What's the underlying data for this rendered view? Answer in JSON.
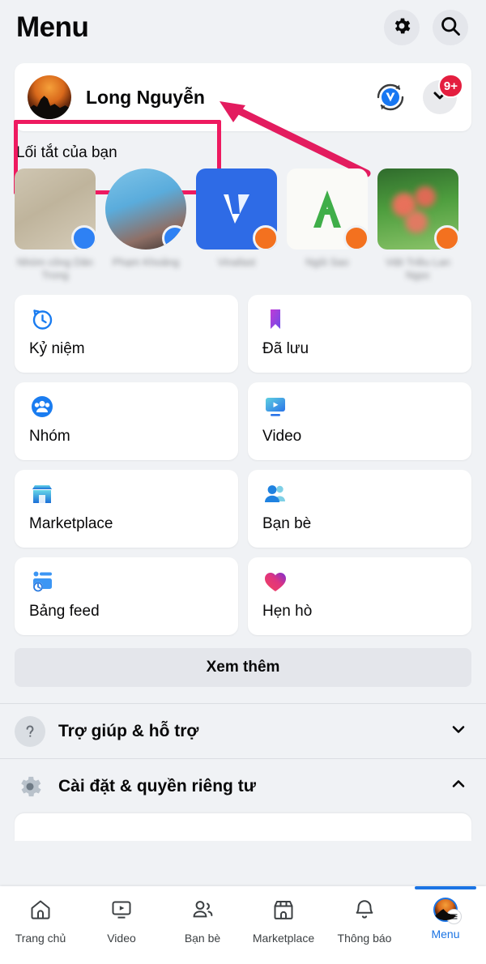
{
  "header": {
    "title": "Menu",
    "settings_icon": "gear-icon",
    "search_icon": "search-icon"
  },
  "profile": {
    "name": "Long Nguyễn",
    "switch_account_icon": "account-switch-icon",
    "expand_icon": "chevron-down-icon",
    "notification_badge": "9+"
  },
  "annotation": {
    "highlight_color": "#EE1A60",
    "arrow_color": "#E31C5F"
  },
  "shortcuts": {
    "label": "Lối tắt của bạn",
    "items": [
      {
        "label": "Nhóm công Dân Trong",
        "badge": "group-badge-blue"
      },
      {
        "label": "Phạm Khoảng",
        "badge": "group-badge-blue"
      },
      {
        "label": "Vinafast",
        "badge": "page-badge-orange"
      },
      {
        "label": "Ngôi Sao",
        "badge": "page-badge-orange"
      },
      {
        "label": "Việt Triều Lan Ngọc",
        "badge": "page-badge-orange"
      }
    ]
  },
  "tiles": [
    {
      "label": "Kỷ niệm",
      "icon": "memories-clock-icon"
    },
    {
      "label": "Đã lưu",
      "icon": "bookmark-icon"
    },
    {
      "label": "Nhóm",
      "icon": "groups-icon"
    },
    {
      "label": "Video",
      "icon": "video-icon"
    },
    {
      "label": "Marketplace",
      "icon": "marketplace-icon"
    },
    {
      "label": "Bạn bè",
      "icon": "friends-icon"
    },
    {
      "label": "Bảng feed",
      "icon": "feeds-icon"
    },
    {
      "label": "Hẹn hò",
      "icon": "dating-heart-icon"
    }
  ],
  "see_more": {
    "label": "Xem thêm"
  },
  "accordion": [
    {
      "label": "Trợ giúp & hỗ trợ",
      "icon": "question-mark-icon",
      "chevron": "chevron-down-icon",
      "expanded": "false"
    },
    {
      "label": "Cài đặt & quyền riêng tư",
      "icon": "gear-icon",
      "chevron": "chevron-up-icon",
      "expanded": "true"
    }
  ],
  "bottom_nav": {
    "active": "Menu",
    "items": [
      {
        "label": "Trang chủ",
        "icon": "home-icon"
      },
      {
        "label": "Video",
        "icon": "video-icon"
      },
      {
        "label": "Bạn bè",
        "icon": "friends-icon"
      },
      {
        "label": "Marketplace",
        "icon": "marketplace-icon"
      },
      {
        "label": "Thông báo",
        "icon": "bell-icon"
      },
      {
        "label": "Menu",
        "icon": "avatar-menu-icon"
      }
    ]
  }
}
